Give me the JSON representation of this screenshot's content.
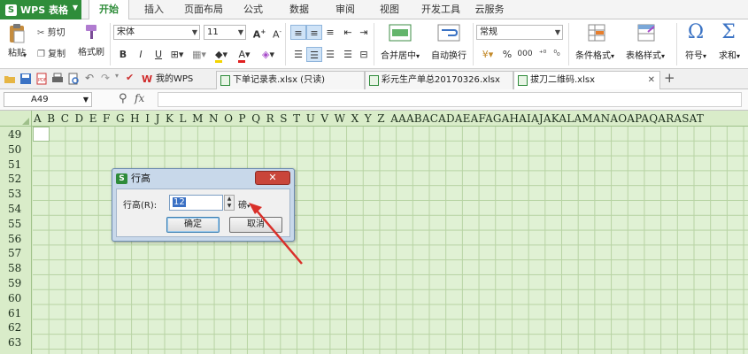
{
  "app": {
    "name": "WPS 表格",
    "logo_letter": "S"
  },
  "menu": {
    "tabs": [
      "开始",
      "插入",
      "页面布局",
      "公式",
      "数据",
      "审阅",
      "视图",
      "开发工具",
      "云服务"
    ],
    "active": "开始"
  },
  "ribbon": {
    "paste": "粘贴",
    "cut": "剪切",
    "copy": "复制",
    "format_painter": "格式刷",
    "font_name": "宋体",
    "font_size": "11",
    "bold": "B",
    "italic": "I",
    "underline": "U",
    "merge_center": "合并居中",
    "wrap_text": "自动换行",
    "number_format": "常规",
    "conditional_format": "条件格式",
    "table_style": "表格样式",
    "symbol": "符号",
    "sum": "求和",
    "percent": "%",
    "thousands": "000"
  },
  "docbar": {
    "tabs": [
      {
        "label": "我的WPS"
      },
      {
        "label": "下单记录表.xlsx (只读)"
      },
      {
        "label": "彩元生产单总20170326.xlsx"
      },
      {
        "label": "拔刀二维码.xlsx"
      }
    ],
    "add": "+"
  },
  "formula_bar": {
    "cell_ref": "A49",
    "fx": "fx"
  },
  "grid": {
    "columns": [
      "A",
      "B",
      "C",
      "D",
      "E",
      "F",
      "G",
      "H",
      "I",
      "J",
      "K",
      "L",
      "M",
      "N",
      "O",
      "P",
      "Q",
      "R",
      "S",
      "T",
      "U",
      "V",
      "W",
      "X",
      "Y",
      "Z",
      "AA",
      "AB",
      "AC",
      "AD",
      "AE",
      "AF",
      "AG",
      "AH",
      "AI",
      "AJ",
      "AK",
      "AL",
      "AM",
      "AN",
      "AO",
      "AP",
      "AQ",
      "AR",
      "AS",
      "AT"
    ],
    "rows": [
      "49",
      "50",
      "51",
      "52",
      "53",
      "54",
      "55",
      "56",
      "57",
      "58",
      "59",
      "60",
      "61",
      "62",
      "63"
    ],
    "active_cell": "A49"
  },
  "dialog": {
    "title": "行高",
    "close": "✕",
    "label": "行高(R):",
    "value": "12",
    "unit": "磅",
    "ok": "确定",
    "cancel": "取消"
  },
  "colors": {
    "brand": "#2f8d3a",
    "grid_bg": "#e0f1d4",
    "arrow": "#d9302a"
  }
}
